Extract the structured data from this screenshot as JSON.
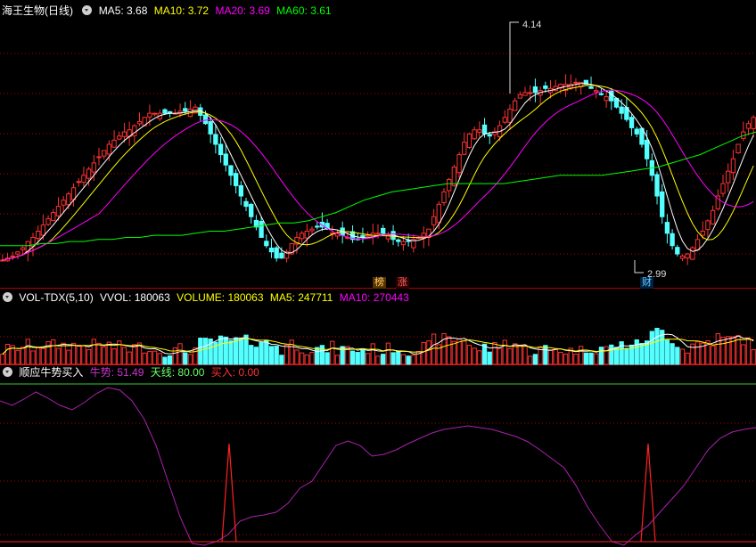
{
  "main": {
    "stock": "海王生物(日线)",
    "ma5_label": "MA5: 3.68",
    "ma10_label": "MA10: 3.72",
    "ma20_label": "MA20: 3.69",
    "ma60_label": "MA60: 3.61",
    "high_label": "4.14",
    "low_label": "2.99",
    "tag_bang": "榜",
    "tag_zhang": "涨",
    "tag_cai": "财"
  },
  "vol": {
    "name": "VOL-TDX(5,10)",
    "vvol": "VVOL: 180063",
    "volume": "VOLUME: 180063",
    "ma5": "MA5: 247711",
    "ma10": "MA10: 270443"
  },
  "ind": {
    "name": "顺应牛势买入",
    "niushi": "牛势: 51.49",
    "tianxian": "天线: 80.00",
    "mairu": "买入: 0.00"
  },
  "colors": {
    "up": "#ff3232",
    "down": "#54ffff",
    "ma5": "#ffffff",
    "ma10": "#ffff00",
    "ma20": "#ff00ff",
    "ma60": "#00ff00",
    "grid": "#b00000"
  },
  "chart_data": {
    "type": "candlestick",
    "price_range": [
      2.99,
      4.14
    ],
    "closes": [
      2.99,
      3.0,
      3.01,
      3.03,
      3.05,
      3.08,
      3.1,
      3.13,
      3.16,
      3.19,
      3.22,
      3.25,
      3.28,
      3.31,
      3.34,
      3.37,
      3.4,
      3.43,
      3.46,
      3.49,
      3.52,
      3.55,
      3.57,
      3.59,
      3.61,
      3.62,
      3.64,
      3.66,
      3.68,
      3.7,
      3.7,
      3.7,
      3.7,
      3.7,
      3.7,
      3.71,
      3.71,
      3.72,
      3.73,
      3.69,
      3.65,
      3.6,
      3.55,
      3.5,
      3.45,
      3.4,
      3.35,
      3.3,
      3.25,
      3.2,
      3.15,
      3.1,
      3.06,
      3.03,
      3.0,
      3.0,
      3.03,
      3.07,
      3.1,
      3.12,
      3.13,
      3.14,
      3.15,
      3.15,
      3.14,
      3.12,
      3.12,
      3.11,
      3.1,
      3.09,
      3.09,
      3.1,
      3.11,
      3.12,
      3.12,
      3.12,
      3.11,
      3.09,
      3.08,
      3.08,
      3.08,
      3.09,
      3.1,
      3.12,
      3.14,
      3.2,
      3.26,
      3.32,
      3.38,
      3.44,
      3.5,
      3.56,
      3.6,
      3.62,
      3.62,
      3.6,
      3.59,
      3.61,
      3.64,
      3.68,
      3.72,
      3.76,
      3.79,
      3.8,
      3.8,
      3.8,
      3.81,
      3.82,
      3.82,
      3.83,
      3.84,
      3.84,
      3.84,
      3.85,
      3.85,
      3.84,
      3.82,
      3.81,
      3.79,
      3.78,
      3.76,
      3.73,
      3.7,
      3.67,
      3.63,
      3.6,
      3.55,
      3.48,
      3.4,
      3.3,
      3.2,
      3.12,
      3.06,
      3.02,
      3.01,
      3.02,
      3.05,
      3.09,
      3.13,
      3.18,
      3.23,
      3.3,
      3.36,
      3.42,
      3.48,
      3.55,
      3.61,
      3.65,
      3.68
    ],
    "ma60": [
      3.06,
      3.06,
      3.06,
      3.07,
      3.07,
      3.08,
      3.08,
      3.09,
      3.09,
      3.1,
      3.1,
      3.11,
      3.11,
      3.11,
      3.12,
      3.13,
      3.13,
      3.14,
      3.15,
      3.16,
      3.17,
      3.17,
      3.18,
      3.2,
      3.22,
      3.25,
      3.28,
      3.3,
      3.32,
      3.33,
      3.34,
      3.35,
      3.36,
      3.36,
      3.36,
      3.36,
      3.36,
      3.37,
      3.38,
      3.39,
      3.4,
      3.4,
      3.4,
      3.4,
      3.41,
      3.42,
      3.43,
      3.44,
      3.46,
      3.48,
      3.5,
      3.53,
      3.56,
      3.59,
      3.61
    ],
    "volume_ma5": 247711,
    "volume_ma10": 270443,
    "indicator": {
      "niushi": 51.49,
      "tianxian": 80.0,
      "mairu": 0.0
    }
  }
}
